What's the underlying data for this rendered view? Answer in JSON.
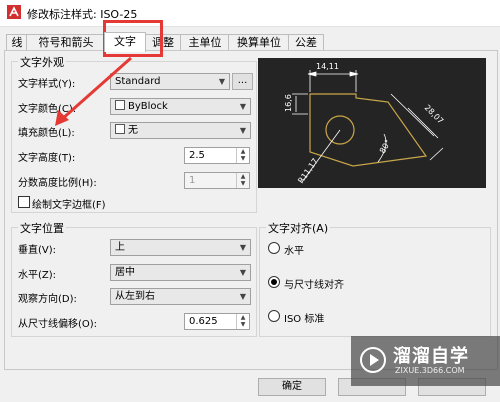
{
  "window": {
    "title": "修改标注样式: ISO-25"
  },
  "tabs": [
    {
      "label": "线"
    },
    {
      "label": "符号和箭头"
    },
    {
      "label": "文字"
    },
    {
      "label": "调整"
    },
    {
      "label": "主单位"
    },
    {
      "label": "换算单位"
    },
    {
      "label": "公差"
    }
  ],
  "text_appearance": {
    "group_label": "文字外观",
    "style_label": "文字样式(Y):",
    "style_value": "Standard",
    "style_button": "...",
    "color_label": "文字颜色(C):",
    "color_value": "ByBlock",
    "fill_label": "填充颜色(L):",
    "fill_value": "无",
    "height_label": "文字高度(T):",
    "height_value": "2.5",
    "fraction_label": "分数高度比例(H):",
    "fraction_value": "1",
    "frame_label": "绘制文字边框(F)"
  },
  "text_placement": {
    "group_label": "文字位置",
    "vertical_label": "垂直(V):",
    "vertical_value": "上",
    "horizontal_label": "水平(Z):",
    "horizontal_value": "居中",
    "view_label": "观察方向(D):",
    "view_value": "从左到右",
    "offset_label": "从尺寸线偏移(O):",
    "offset_value": "0.625"
  },
  "text_alignment": {
    "group_label": "文字对齐(A)",
    "options": [
      {
        "label": "水平",
        "selected": false
      },
      {
        "label": "与尺寸线对齐",
        "selected": true
      },
      {
        "label": "ISO 标准",
        "selected": false
      }
    ]
  },
  "preview": {
    "dim_top": "14,11",
    "dim_left": "16,6",
    "dim_right": "28,07",
    "dim_angle": "80°",
    "dim_radius": "R11,17"
  },
  "buttons": {
    "ok": "确定"
  },
  "watermark": {
    "name": "溜溜自学",
    "url": "ZIXUE.3D66.COM"
  },
  "colors": {
    "highlight": "#e53935",
    "preview_bg": "#242424",
    "preview_line": "#c9a64a",
    "dim_text": "#ffffff"
  }
}
